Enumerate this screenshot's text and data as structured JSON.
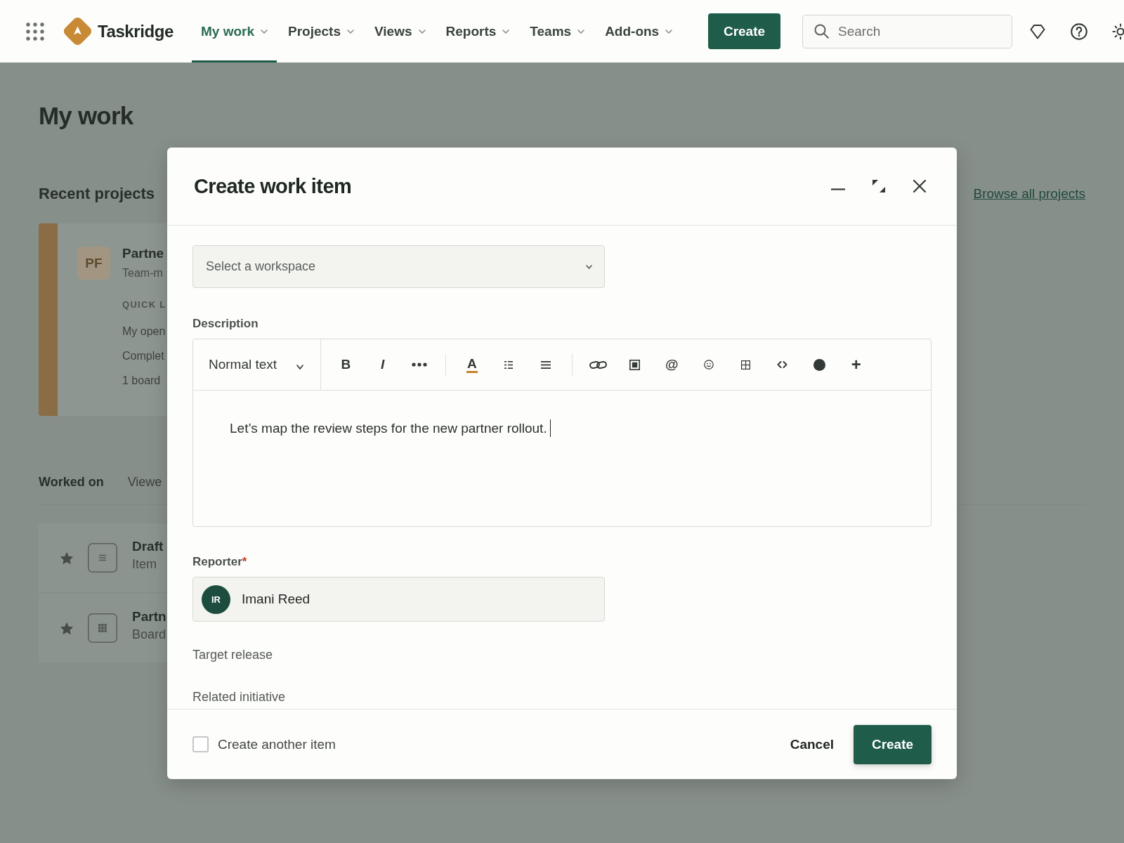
{
  "top_nav": {
    "brand": "Taskridge",
    "menu": [
      {
        "label": "My work",
        "selected": true
      },
      {
        "label": "Projects",
        "selected": false
      },
      {
        "label": "Views",
        "selected": false
      },
      {
        "label": "Reports",
        "selected": false
      },
      {
        "label": "Teams",
        "selected": false
      },
      {
        "label": "Add-ons",
        "selected": false
      }
    ],
    "create_button": "Create",
    "search": {
      "placeholder": "Search"
    }
  },
  "page": {
    "title": "My work",
    "recent_projects": {
      "heading": "Recent projects",
      "link": "Browse all projects",
      "cards": [
        {
          "initials": "PF",
          "name": "Partne",
          "subtitle": "Team-m",
          "section_heading": "QUICK L",
          "links": [
            "My open",
            "Complet",
            "1 board"
          ],
          "color": "#8a6c45"
        }
      ]
    },
    "work_tabs": [
      {
        "label": "Worked on",
        "selected": true
      },
      {
        "label": "Viewe",
        "selected": false
      }
    ],
    "work_items": [
      {
        "kind": "item",
        "starred": true,
        "title": "Draft",
        "type": "Item"
      },
      {
        "kind": "board",
        "starred": true,
        "title": "Partn",
        "type": "Board"
      }
    ]
  },
  "dialog": {
    "title": "Create work item",
    "workspace": {
      "placeholder": "Select a workspace"
    },
    "description": {
      "label": "Description",
      "text_style": "Normal text",
      "toolbar": [
        {
          "kind": "bold",
          "glyph": "B"
        },
        {
          "kind": "italic",
          "glyph": "I"
        },
        {
          "kind": "more"
        },
        {
          "kind": "divider"
        },
        {
          "kind": "text-color",
          "glyph": "A"
        },
        {
          "kind": "list"
        },
        {
          "kind": "align"
        },
        {
          "kind": "divider"
        },
        {
          "kind": "link"
        },
        {
          "kind": "media"
        },
        {
          "kind": "mention",
          "glyph": "@"
        },
        {
          "kind": "emoji"
        },
        {
          "kind": "table"
        },
        {
          "kind": "code"
        },
        {
          "kind": "status"
        },
        {
          "kind": "insert",
          "glyph": "+"
        }
      ],
      "text": "Let’s map the review steps for the new partner rollout.",
      "focused": true
    },
    "reporter": {
      "label": "Reporter",
      "required_mark": "*",
      "initials": "IR",
      "name": "Imani Reed"
    },
    "fields": [
      {
        "label": "Target release"
      },
      {
        "label": "Related initiative"
      }
    ],
    "create_another": {
      "label": "Create another item",
      "checked": false
    },
    "cancel_button": "Cancel",
    "create_button": "Create"
  }
}
